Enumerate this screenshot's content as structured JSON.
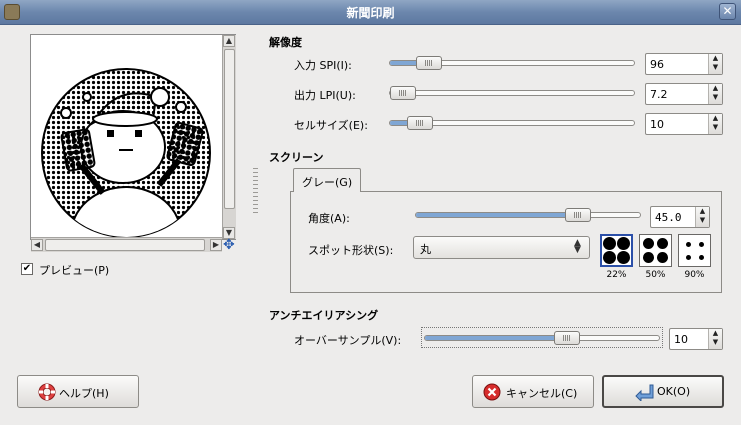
{
  "window": {
    "title": "新聞印刷"
  },
  "preview": {
    "checkbox_label": "プレビュー(P)",
    "checked": true
  },
  "resolution": {
    "heading": "解像度",
    "input_spi": {
      "label": "入力 SPI(I):",
      "value": "96",
      "level": 0.12
    },
    "output_lpi": {
      "label": "出力 LPI(U):",
      "value": "7.2",
      "level": 0.0
    },
    "cell_size": {
      "label": "セルサイズ(E):",
      "value": "10",
      "level": 0.08
    }
  },
  "screen": {
    "heading": "スクリーン",
    "tab_label": "グレー(G)",
    "angle": {
      "label": "角度(A):",
      "value": "45.0",
      "level": 0.75
    },
    "spot_shape": {
      "label": "スポット形状(S):",
      "value": "丸"
    },
    "shapes": [
      {
        "name": "22%",
        "selected": true
      },
      {
        "name": "50%",
        "selected": false
      },
      {
        "name": "90%",
        "selected": false
      }
    ]
  },
  "antialiasing": {
    "heading": "アンチエイリアシング",
    "oversample": {
      "label": "オーバーサンプル(V):",
      "value": "10",
      "level": 0.62
    }
  },
  "buttons": {
    "help": "ヘルプ(H)",
    "cancel": "キャンセル(C)",
    "ok": "OK(O)"
  },
  "colors": {
    "accent": "#7fa6d4",
    "titlebar": "#6c87ad",
    "selected_border": "#2b4fa8"
  }
}
